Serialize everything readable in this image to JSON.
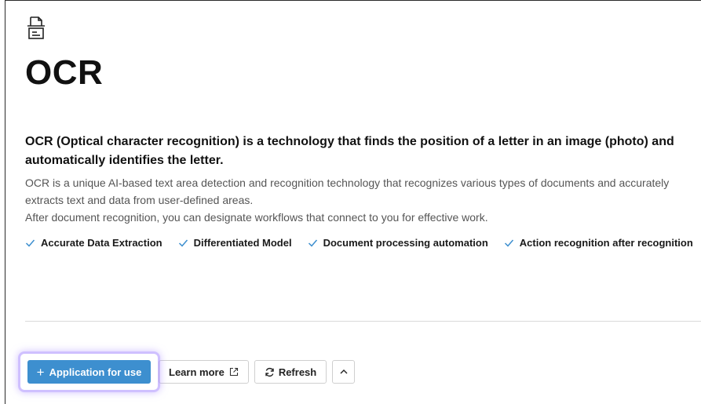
{
  "page": {
    "title": "OCR",
    "headline": "OCR (Optical character recognition) is a technology that finds the position of a letter in an image (photo) and automatically identifies the letter.",
    "description": [
      "OCR is a unique AI-based text area detection and recognition technology that recognizes various types of documents and accurately extracts text and data from user-defined areas.",
      "After document recognition, you can designate workflows that connect to you for effective work."
    ],
    "features": [
      "Accurate Data Extraction",
      "Differentiated Model",
      "Document processing automation",
      "Action recognition after recognition"
    ]
  },
  "actions": {
    "apply_label": "Application for use",
    "learn_more_label": "Learn more",
    "refresh_label": "Refresh"
  },
  "icons": {
    "header": "document-icon",
    "feature": "check-icon",
    "apply": "plus-icon",
    "learn_more": "external-link-icon",
    "refresh": "refresh-icon",
    "collapse": "chevron-up-icon"
  },
  "colors": {
    "primary": "#3d8fcf",
    "check": "#3d8fcf",
    "focus_glow": "#a88cff"
  }
}
